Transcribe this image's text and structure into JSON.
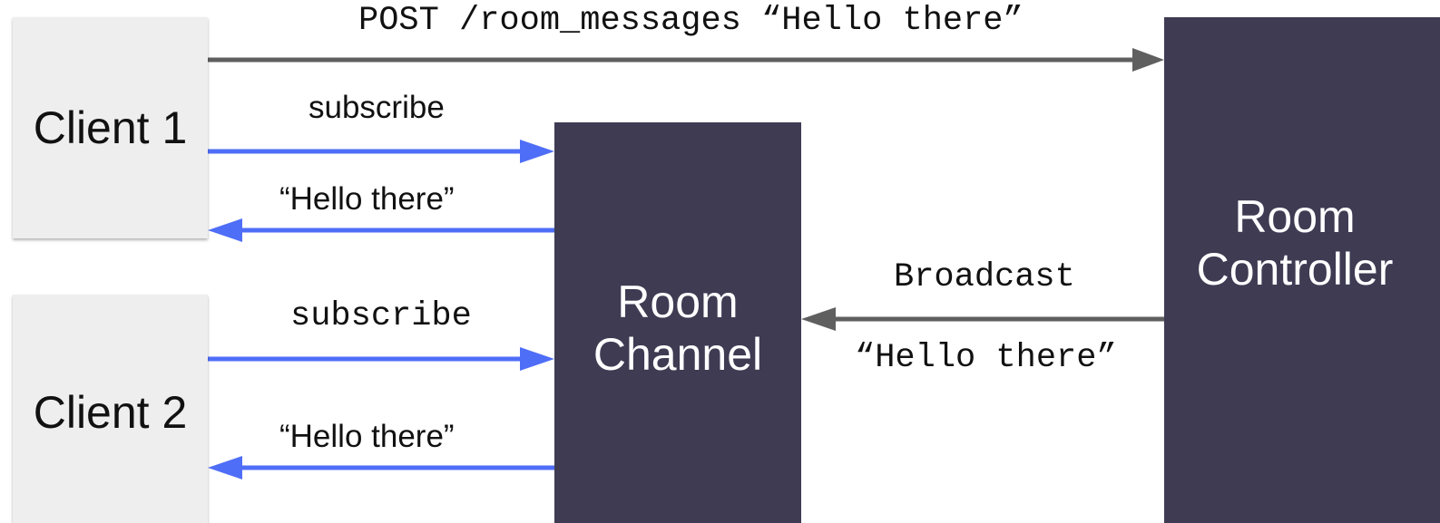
{
  "colors": {
    "client_box_bg": "#eeeeee",
    "server_box_bg": "#3e3b53",
    "websocket_arrow": "#4f6ef7",
    "http_arrow": "#5f5f5f"
  },
  "nodes": {
    "client_1": {
      "label": "Client 1"
    },
    "client_2": {
      "label": "Client 2"
    },
    "room_channel": {
      "label": "Room\nChannel"
    },
    "room_controller": {
      "label": "Room\nController"
    }
  },
  "edges": {
    "post_request": {
      "label": "POST /room_messages “Hello there”"
    },
    "client_1_subscribe": {
      "label": "subscribe"
    },
    "client_1_message": {
      "label": "“Hello there”"
    },
    "client_2_subscribe": {
      "label": "subscribe"
    },
    "client_2_message": {
      "label": "“Hello there”"
    },
    "broadcast": {
      "label": "Broadcast"
    },
    "broadcast_message": {
      "label": "“Hello there”"
    }
  }
}
